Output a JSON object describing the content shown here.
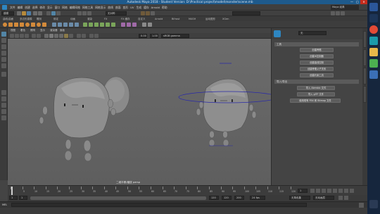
{
  "window": {
    "title": "Autodesk Maya 2018 - Student Version: D:\\Practical project\\model\\monster\\scene.mb",
    "minimize": "—",
    "maximize": "□",
    "close": "✕"
  },
  "menubar": {
    "items": [
      "文件",
      "编辑",
      "创建",
      "选择",
      "修改",
      "显示",
      "窗口",
      "网格",
      "编辑网格",
      "网格工具",
      "网格显示",
      "曲线",
      "曲面",
      "变形",
      "UV",
      "生成",
      "缓存",
      "Arnold",
      "帮助"
    ],
    "workspace_label": "Maya 经典"
  },
  "status_line": {
    "mode": "建模",
    "search_placeholder": "",
    "symmetry": "无对称"
  },
  "shelf_tabs": [
    "曲线/曲面",
    "多边形建模",
    "雕刻",
    "绑定",
    "动画",
    "渲染",
    "FX",
    "FX 缓存",
    "自定义",
    "Arnold",
    "Bifrost",
    "MASH",
    "运动图形",
    "XGen"
  ],
  "viewport": {
    "menu": [
      "视图",
      "着色",
      "照明",
      "显示",
      "渲染器",
      "面板"
    ],
    "gamma": "sRGB gamma",
    "exposure": "0.00",
    "gamma_value": "1.00",
    "camera_label": "二维平移/缩放 persp"
  },
  "attribute_panel": {
    "title": "",
    "tab": "无",
    "section1": "工具",
    "buttons": [
      "创建骨骼",
      "创建IK控制器",
      "创建曲线控制",
      "创建骨骼父子关系",
      "创建约束工具"
    ],
    "section2": "导入/导出",
    "buttons2": [
      "导入 Alembic 文件",
      "导入 glTF 文件",
      "使用现有 FBX 和 Bitmap 文件"
    ]
  },
  "timeline": {
    "ticks": [
      "1",
      "5",
      "10",
      "15",
      "20",
      "25",
      "30",
      "35",
      "40",
      "45",
      "50",
      "55",
      "60",
      "65",
      "70",
      "75",
      "80",
      "85",
      "90",
      "95",
      "100",
      "105",
      "110",
      "115",
      "120"
    ],
    "current_frame": "1"
  },
  "range": {
    "start": "1",
    "range_start": "1",
    "range_end": "120",
    "end": "120",
    "end2": "200",
    "fps": "24 fps",
    "char_set": "无角色集",
    "anim_layer": "无动画层"
  },
  "command_line": {
    "lang": "MEL",
    "placeholder": ""
  },
  "help_line": {
    "text": ""
  },
  "colors": {
    "accent": "#5285a6",
    "titlebar": "#1e5a8c",
    "close": "#c42b1c"
  }
}
